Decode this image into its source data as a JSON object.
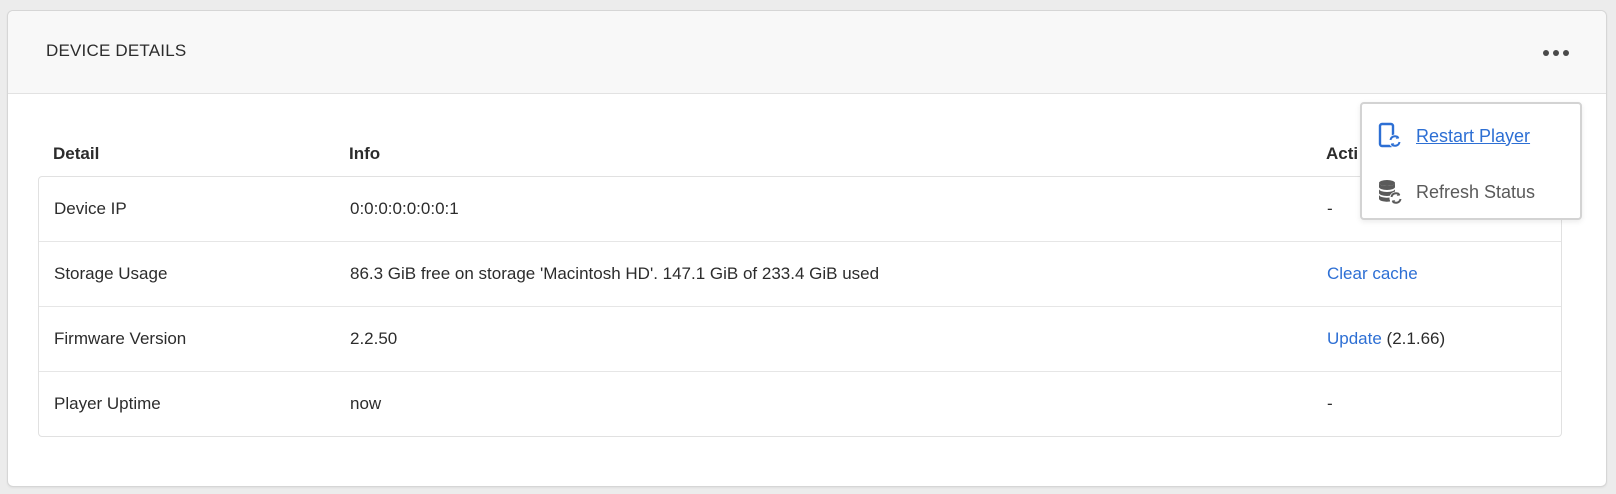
{
  "card": {
    "title": "DEVICE DETAILS",
    "more_icon": "ellipsis-horizontal-icon"
  },
  "table": {
    "headers": {
      "detail": "Detail",
      "info": "Info",
      "actions": "Acti"
    },
    "rows": [
      {
        "detail": "Device IP",
        "info": "0:0:0:0:0:0:0:1",
        "action": "-"
      },
      {
        "detail": "Storage Usage",
        "info": "86.3 GiB free on storage 'Macintosh HD'. 147.1 GiB of 233.4 GiB used",
        "action_link": "Clear cache"
      },
      {
        "detail": "Firmware Version",
        "info": "2.2.50",
        "action_link": "Update",
        "action_suffix": " (2.1.66)"
      },
      {
        "detail": "Player Uptime",
        "info": "now",
        "action": "-"
      }
    ]
  },
  "menu": {
    "items": [
      {
        "label": "Restart Player",
        "icon": "device-restart-icon"
      },
      {
        "label": "Refresh Status",
        "icon": "database-refresh-icon"
      }
    ]
  },
  "colors": {
    "link": "#2d6fd4",
    "icon_blue": "#2d6fd4",
    "icon_gray": "#5a5a5a"
  }
}
